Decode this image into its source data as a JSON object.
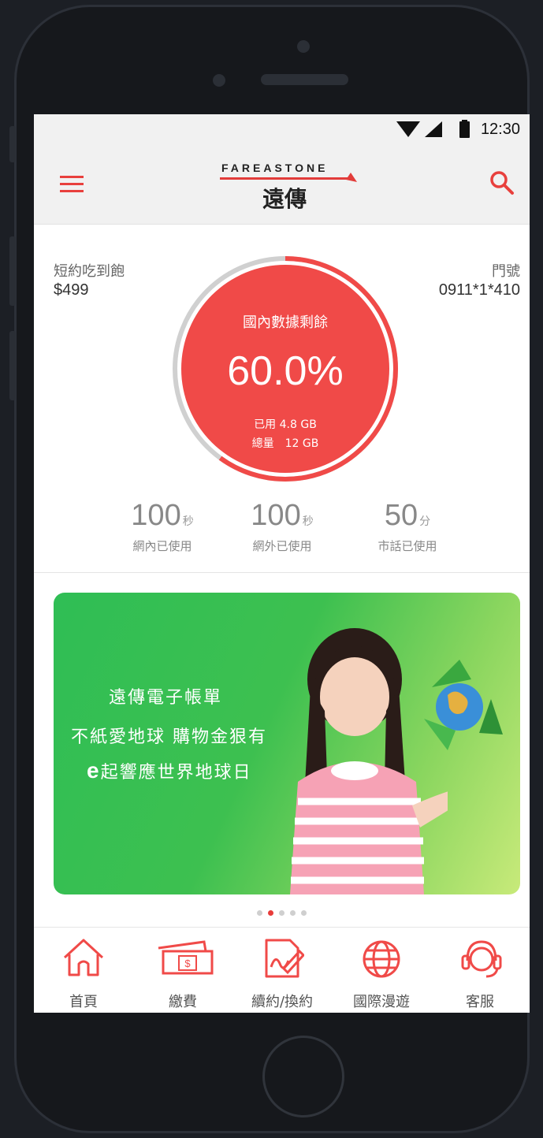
{
  "status_bar": {
    "time": "12:30"
  },
  "header": {
    "brand_en": "FAREASTONE",
    "brand_cn": "遠傳"
  },
  "plan": {
    "name": "短約吃到飽",
    "price": "$499"
  },
  "number": {
    "label": "門號",
    "value": "0911*1*410"
  },
  "data_usage": {
    "title": "國內數據剩餘",
    "percent_text": "60.0%",
    "remaining_fraction": 0.6,
    "used": "已用 4.8 GB",
    "total": "總量　12 GB"
  },
  "stats": [
    {
      "value": "100",
      "unit": "秒",
      "label": "網內已使用"
    },
    {
      "value": "100",
      "unit": "秒",
      "label": "網外已使用"
    },
    {
      "value": "50",
      "unit": "分",
      "label": "市話已使用"
    }
  ],
  "banner": {
    "line1": "遠傳電子帳單",
    "line2": "不紙愛地球 購物金狠有",
    "line3_e": "e",
    "line3_rest": "起響應世界地球日"
  },
  "carousel": {
    "count": 5,
    "active_index": 1
  },
  "tabbar": [
    {
      "label": "首頁",
      "icon": "home-icon"
    },
    {
      "label": "繳費",
      "icon": "bill-icon"
    },
    {
      "label": "續約/換約",
      "icon": "contract-icon"
    },
    {
      "label": "國際漫遊",
      "icon": "globe-icon"
    },
    {
      "label": "客服",
      "icon": "headset-icon"
    }
  ],
  "colors": {
    "accent": "#f04a48",
    "ring_gray": "#d0d0d0",
    "banner_green": "#34c154"
  }
}
